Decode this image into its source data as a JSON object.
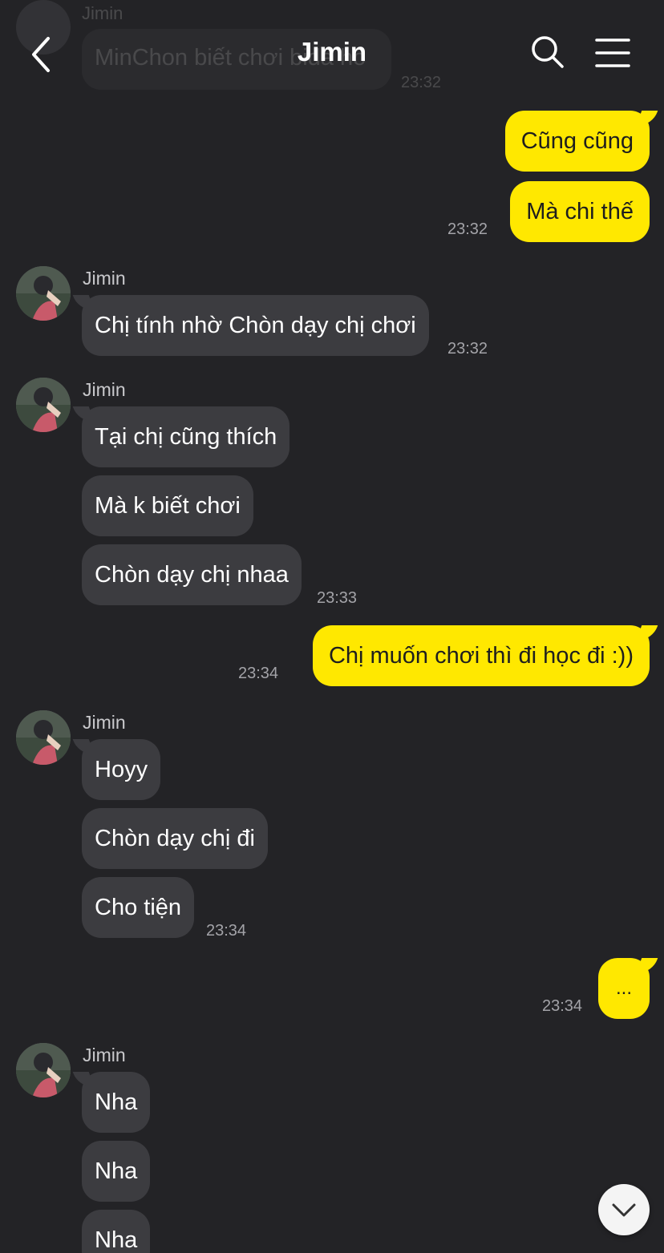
{
  "header": {
    "title": "Jimin",
    "back_icon": "chevron-left-icon",
    "search_icon": "search-icon",
    "menu_icon": "hamburger-menu-icon"
  },
  "colors": {
    "background": "#232326",
    "incoming_bubble": "#3c3c40",
    "outgoing_bubble": "#ffe800"
  },
  "ghost": {
    "name": "Jimin",
    "text": "MinChon biết chơi bida hô",
    "time": "23:32"
  },
  "messages": {
    "out1": {
      "text": "Cũng cũng"
    },
    "out2": {
      "text": "Mà chi thế",
      "time": "23:32"
    },
    "g1": {
      "name": "Jimin",
      "b0": "Chị tính nhờ Chòn dạy chị chơi",
      "time": "23:32"
    },
    "g2": {
      "name": "Jimin",
      "b0": "Tại chị cũng thích",
      "b1": "Mà k biết chơi",
      "b2": "Chòn dạy chị nhaa",
      "time": "23:33"
    },
    "out3": {
      "text": "Chị muốn chơi thì đi học đi :))",
      "time": "23:34"
    },
    "g3": {
      "name": "Jimin",
      "b0": "Hoyy",
      "b1": "Chòn dạy chị đi",
      "b2": "Cho tiện",
      "time": "23:34"
    },
    "out4": {
      "text": "...",
      "time": "23:34"
    },
    "g4": {
      "name": "Jimin",
      "b0": "Nha",
      "b1": "Nha",
      "b2": "Nha"
    }
  },
  "scroll_button": {
    "icon": "chevron-down-icon"
  }
}
